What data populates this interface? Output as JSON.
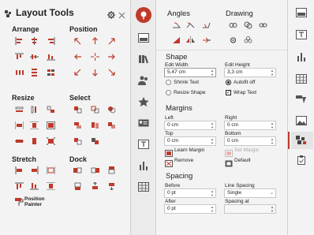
{
  "left_panel": {
    "title": "Layout Tools",
    "sections": {
      "arrange": "Arrange",
      "position": "Position",
      "resize": "Resize",
      "select": "Select",
      "stretch": "Stretch",
      "dock": "Dock"
    },
    "position_painter_line1": "Position",
    "position_painter_line2": "Painter"
  },
  "right_panel": {
    "angles": "Angles",
    "drawing": "Drawing",
    "shape": {
      "heading": "Shape",
      "edit_width_label": "Edit Width",
      "edit_width_value": "5,47 cm",
      "edit_height_label": "Edit Height",
      "edit_height_value": "3,3 cm",
      "shrink_text": "Shrink Text",
      "autofit_off": "Autofit off",
      "resize_shape": "Resize Shape",
      "wrap_text": "Wrap Text"
    },
    "margins": {
      "heading": "Margins",
      "left_label": "Left",
      "left_value": "0 cm",
      "right_label": "Right",
      "right_value": "0 cm",
      "top_label": "Top",
      "top_value": "0 cm",
      "bottom_label": "Bottom",
      "bottom_value": "0 cm",
      "learn_margin": "Learn Margin",
      "set_margin": "Set Margin",
      "remove": "Remove",
      "default": "Default"
    },
    "spacing": {
      "heading": "Spacing",
      "before_label": "Before",
      "before_value": "0 pt",
      "line_spacing_label": "Line Spacing",
      "line_spacing_value": "Single",
      "after_label": "After",
      "after_value": "0 pt",
      "spacing_at_label": "Spacing at",
      "spacing_at_value": ""
    }
  },
  "colors": {
    "accent": "#c0392b",
    "icon_gray": "#555555",
    "panel_bg": "#f3f3f3"
  }
}
